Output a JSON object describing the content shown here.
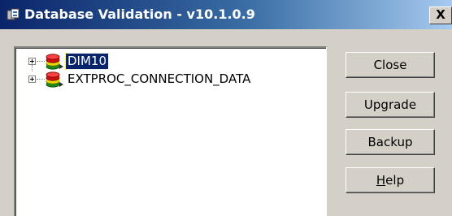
{
  "window": {
    "title": "Database Validation - v10.1.0.9",
    "close_glyph": "X",
    "app_icon": "database-validation-app-icon"
  },
  "tree": {
    "nodes": [
      {
        "label": "DIM10",
        "selected": true,
        "icon": "database-stack-icon",
        "expander": "plus-box-icon"
      },
      {
        "label": "EXTPROC_CONNECTION_DATA",
        "selected": false,
        "icon": "database-stack-icon",
        "expander": "plus-box-icon"
      }
    ]
  },
  "buttons": {
    "close": "Close",
    "upgrade": "Upgrade",
    "backup": "Backup",
    "help_mnemonic": "H",
    "help_rest": "elp"
  },
  "colors": {
    "titlebar_start": "#0a246a",
    "titlebar_end": "#a6caf0",
    "face": "#d4d0c8",
    "selection": "#0a246a"
  }
}
